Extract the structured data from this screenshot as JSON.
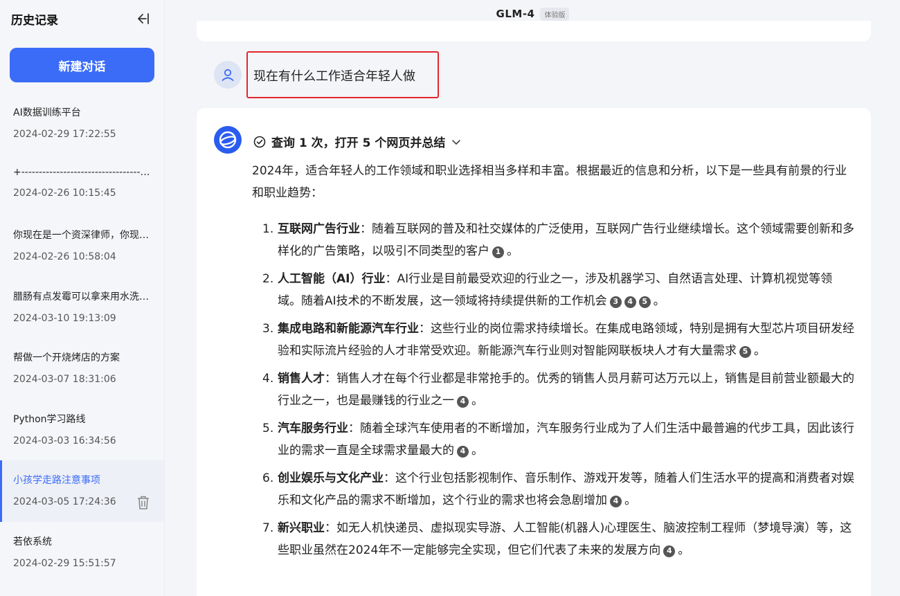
{
  "sidebar": {
    "title": "历史记录",
    "new_chat": "新建对话",
    "items": [
      {
        "name": "AI数据训练平台",
        "time": "2024-02-29 17:22:55"
      },
      {
        "name": "+-----------------------------------------------",
        "time": "2024-02-26 10:15:45"
      },
      {
        "name": "你现在是一个资深律师，你现在需要",
        "time": "2024-02-26 10:58:04"
      },
      {
        "name": "腊肠有点发霉可以拿来用水洗一洗",
        "time": "2024-03-10 19:13:09"
      },
      {
        "name": "帮做一个开烧烤店的方案",
        "time": "2024-03-07 18:31:06"
      },
      {
        "name": "Python学习路线",
        "time": "2024-03-03 16:34:56"
      },
      {
        "name": "小孩学走路注意事项",
        "time": "2024-03-05 17:24:36"
      },
      {
        "name": "若依系统",
        "time": "2024-02-29 15:51:57"
      }
    ]
  },
  "header": {
    "model": "GLM-4",
    "badge": "体验版"
  },
  "user_message": "现在有什么工作适合年轻人做",
  "answer": {
    "search_summary": "查询 1 次，打开 5 个网页并总结",
    "intro": "2024年，适合年轻人的工作领域和职业选择相当多样和丰富。根据最近的信息和分析，以下是一些具有前景的行业和职业趋势：",
    "points": [
      {
        "num": "1.",
        "term": "互联网广告行业",
        "text": "：随着互联网的普及和社交媒体的广泛使用，互联网广告行业继续增长。这个领域需要创新和多样化的广告策略，以吸引不同类型的客户",
        "cites": [
          "1"
        ],
        "end": "。"
      },
      {
        "num": "2.",
        "term": "人工智能（AI）行业",
        "text": "：AI行业是目前最受欢迎的行业之一，涉及机器学习、自然语言处理、计算机视觉等领域。随着AI技术的不断发展，这一领域将持续提供新的工作机会",
        "cites": [
          "3",
          "4",
          "5"
        ],
        "end": "。"
      },
      {
        "num": "3.",
        "term": "集成电路和新能源汽车行业",
        "text": "：这些行业的岗位需求持续增长。在集成电路领域，特别是拥有大型芯片项目研发经验和实际流片经验的人才非常受欢迎。新能源汽车行业则对智能网联板块人才有大量需求",
        "cites": [
          "5"
        ],
        "end": "。"
      },
      {
        "num": "4.",
        "term": "销售人才",
        "text": "：销售人才在每个行业都是非常抢手的。优秀的销售人员月薪可达万元以上，销售是目前营业额最大的行业之一，也是最赚钱的行业之一",
        "cites": [
          "4"
        ],
        "end": "。"
      },
      {
        "num": "5.",
        "term": "汽车服务行业",
        "text": "：随着全球汽车使用者的不断增加，汽车服务行业成为了人们生活中最普遍的代步工具，因此该行业的需求一直是全球需求量最大的",
        "cites": [
          "4"
        ],
        "end": "。"
      },
      {
        "num": "6.",
        "term": "创业娱乐与文化产业",
        "text": "：这个行业包括影视制作、音乐制作、游戏开发等，随着人们生活水平的提高和消费者对娱乐和文化产品的需求不断增加，这个行业的需求也将会急剧增加",
        "cites": [
          "4"
        ],
        "end": "。"
      },
      {
        "num": "7.",
        "term": "新兴职业",
        "text": "：如无人机快递员、虚拟现实导游、人工智能(机器人)心理医生、脑波控制工程师（梦境导演）等，这些职业虽然在2024年不一定能够完全实现，但它们代表了未来的发展方向",
        "cites": [
          "4"
        ],
        "end": "。"
      }
    ]
  }
}
